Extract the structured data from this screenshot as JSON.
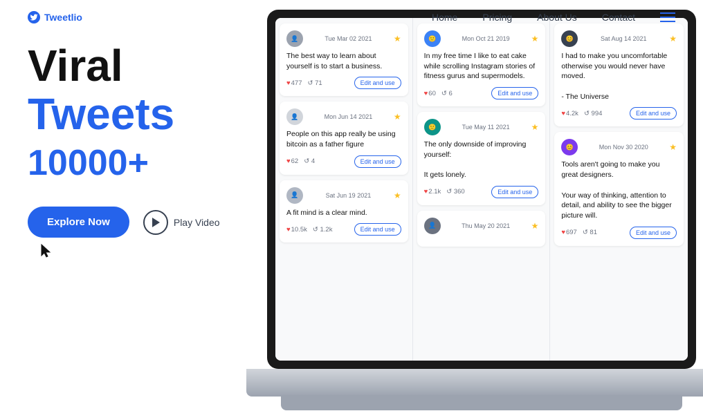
{
  "header": {
    "logo_text": "Tweetlio",
    "nav": [
      {
        "label": "Home",
        "id": "home"
      },
      {
        "label": "Pricing",
        "id": "pricing"
      },
      {
        "label": "About Us",
        "id": "about"
      },
      {
        "label": "Contact",
        "id": "contact"
      }
    ]
  },
  "hero": {
    "line1": "Viral",
    "line2": "Tweets",
    "count": "10000+",
    "explore_btn": "Explore Now",
    "play_btn": "Play Video"
  },
  "tweets": {
    "col1": [
      {
        "date": "Tue Mar 02 2021",
        "text": "The best way to learn about yourself is to start a business.",
        "likes": "477",
        "retweets": "71",
        "avatar_color": "gray"
      },
      {
        "date": "Mon Jun 14 2021",
        "text": "People on this app really be using bitcoin as a father figure",
        "likes": "62",
        "retweets": "4",
        "avatar_color": "gray2"
      },
      {
        "date": "Sat Jun 19 2021",
        "text": "A fit mind is a clear mind.",
        "likes": "10.5k",
        "retweets": "1.2k",
        "avatar_color": "gray3"
      }
    ],
    "col2": [
      {
        "date": "Mon Oct 21 2019",
        "text": "In my free time I like to eat cake while scrolling Instagram stories of fitness gurus and supermodels.",
        "likes": "60",
        "retweets": "6",
        "avatar_color": "blue"
      },
      {
        "date": "Tue May 11 2021",
        "text": "The only downside of improving yourself:\n\nIt gets lonely.",
        "likes": "2.1k",
        "retweets": "360",
        "avatar_color": "teal"
      },
      {
        "date": "Thu May 20 2021",
        "text": "",
        "likes": "",
        "retweets": "",
        "avatar_color": "green"
      }
    ],
    "col3": [
      {
        "date": "Sat Aug 14 2021",
        "text": "I had to make you uncomfortable otherwise you would never have moved.\n\n- The Universe",
        "likes": "4.2k",
        "retweets": "994",
        "avatar_color": "dark"
      },
      {
        "date": "Mon Nov 30 2020",
        "text": "Tools aren't going to make you great designers.\n\nYour way of thinking, attention to detail, and ability to see the bigger picture will.",
        "likes": "697",
        "retweets": "81",
        "avatar_color": "purple"
      }
    ]
  },
  "edit_label": "Edit and use"
}
